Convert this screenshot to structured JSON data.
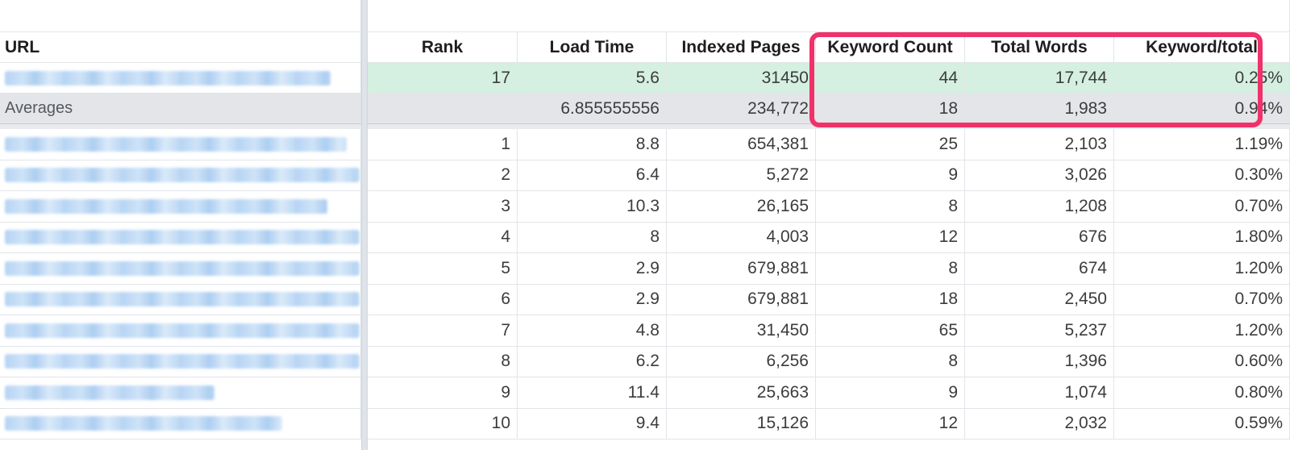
{
  "headers": {
    "url": "URL",
    "rank": "Rank",
    "load_time": "Load Time",
    "indexed_pages": "Indexed Pages",
    "keyword_count": "Keyword Count",
    "total_words": "Total Words",
    "keyword_total": "Keyword/total"
  },
  "highlight_row": {
    "rank": "17",
    "load_time": "5.6",
    "indexed_pages": "31450",
    "keyword_count": "44",
    "total_words": "17,744",
    "keyword_total": "0.25%"
  },
  "averages_row": {
    "label": "Averages",
    "rank": "",
    "load_time": "6.855555556",
    "indexed_pages": "234,772",
    "keyword_count": "18",
    "total_words": "1,983",
    "keyword_total": "0.94%"
  },
  "rows": [
    {
      "rank": "1",
      "load_time": "8.8",
      "indexed_pages": "654,381",
      "keyword_count": "25",
      "total_words": "2,103",
      "keyword_total": "1.19%"
    },
    {
      "rank": "2",
      "load_time": "6.4",
      "indexed_pages": "5,272",
      "keyword_count": "9",
      "total_words": "3,026",
      "keyword_total": "0.30%"
    },
    {
      "rank": "3",
      "load_time": "10.3",
      "indexed_pages": "26,165",
      "keyword_count": "8",
      "total_words": "1,208",
      "keyword_total": "0.70%"
    },
    {
      "rank": "4",
      "load_time": "8",
      "indexed_pages": "4,003",
      "keyword_count": "12",
      "total_words": "676",
      "keyword_total": "1.80%"
    },
    {
      "rank": "5",
      "load_time": "2.9",
      "indexed_pages": "679,881",
      "keyword_count": "8",
      "total_words": "674",
      "keyword_total": "1.20%"
    },
    {
      "rank": "6",
      "load_time": "2.9",
      "indexed_pages": "679,881",
      "keyword_count": "18",
      "total_words": "2,450",
      "keyword_total": "0.70%"
    },
    {
      "rank": "7",
      "load_time": "4.8",
      "indexed_pages": "31,450",
      "keyword_count": "65",
      "total_words": "5,237",
      "keyword_total": "1.20%"
    },
    {
      "rank": "8",
      "load_time": "6.2",
      "indexed_pages": "6,256",
      "keyword_count": "8",
      "total_words": "1,396",
      "keyword_total": "0.60%"
    },
    {
      "rank": "9",
      "load_time": "11.4",
      "indexed_pages": "25,663",
      "keyword_count": "9",
      "total_words": "1,074",
      "keyword_total": "0.80%"
    },
    {
      "rank": "10",
      "load_time": "9.4",
      "indexed_pages": "15,126",
      "keyword_count": "12",
      "total_words": "2,032",
      "keyword_total": "0.59%"
    }
  ],
  "colors": {
    "highlight_row_bg": "#d5f0e1",
    "averages_row_bg": "#e4e5e8",
    "annotation_border": "#f0316a",
    "blurred_url": "#a9cdf2"
  }
}
